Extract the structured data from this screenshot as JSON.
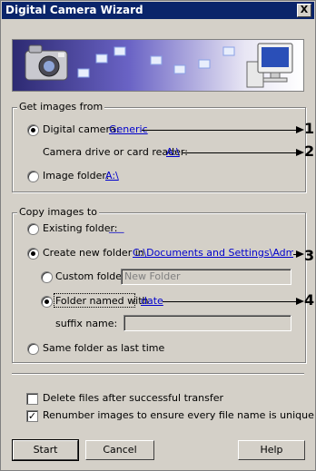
{
  "window": {
    "title": "Digital Camera Wizard",
    "close_label": "X"
  },
  "get_images": {
    "legend": "Get images from",
    "digital_camera_label": "Digital camera:",
    "digital_camera_value": "Generic",
    "drive_label": "Camera drive or card reader:",
    "drive_value": "A:\\",
    "image_folder_label": "Image folder:",
    "image_folder_value": "A:\\",
    "selected": "digital_camera"
  },
  "copy_images": {
    "legend": "Copy images to",
    "existing_label": "Existing folder:",
    "existing_value": "___",
    "create_label": "Create new folder in",
    "create_value": "C:\\Documents and Settings\\Administ",
    "custom_label": "Custom folder:",
    "custom_placeholder": "New Folder",
    "named_label": "Folder named with",
    "named_value": "date",
    "suffix_label": "suffix name:",
    "suffix_value": "",
    "same_label": "Same folder as last time",
    "selected": "create",
    "sub_selected": "named"
  },
  "options": {
    "delete_label": "Delete files after successful transfer",
    "delete_checked": false,
    "renumber_label": "Renumber images to ensure every file name is unique",
    "renumber_checked": true
  },
  "buttons": {
    "start": "Start",
    "cancel": "Cancel",
    "help": "Help"
  },
  "callouts": [
    "1",
    "2",
    "3",
    "4"
  ]
}
